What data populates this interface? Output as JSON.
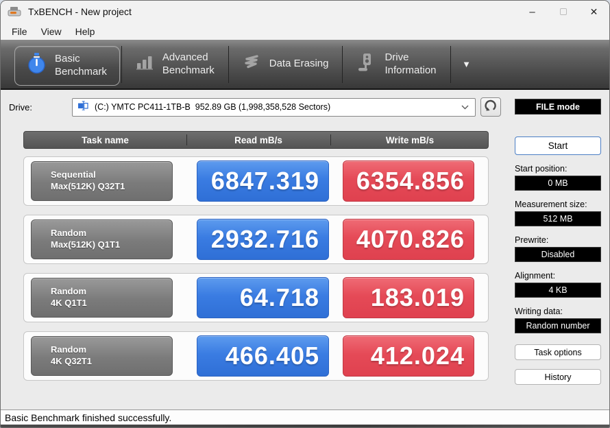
{
  "window": {
    "title": "TxBENCH - New project",
    "minimize_glyph": "–",
    "close_glyph": "✕"
  },
  "menu": {
    "items": [
      "File",
      "View",
      "Help"
    ]
  },
  "toolbar": {
    "tabs": [
      {
        "line1": "Basic",
        "line2": "Benchmark",
        "icon": "stopwatch-icon",
        "active": true
      },
      {
        "line1": "Advanced",
        "line2": "Benchmark",
        "icon": "bar-chart-icon",
        "active": false
      },
      {
        "line1": "Data Erasing",
        "line2": "",
        "icon": "eraser-scribble-icon",
        "active": false
      },
      {
        "line1": "Drive",
        "line2": "Information",
        "icon": "drive-icon",
        "active": false
      }
    ],
    "more_arrow": "▼"
  },
  "drive": {
    "label": "Drive:",
    "selected": "(C:) YMTC PC411-1TB-B  952.89 GB (1,998,358,528 Sectors)"
  },
  "table": {
    "headers": [
      "Task name",
      "Read mB/s",
      "Write mB/s"
    ],
    "rows": [
      {
        "task_line1": "Sequential",
        "task_line2": "Max(512K) Q32T1",
        "read": "6847.319",
        "write": "6354.856"
      },
      {
        "task_line1": "Random",
        "task_line2": "Max(512K) Q1T1",
        "read": "2932.716",
        "write": "4070.826"
      },
      {
        "task_line1": "Random",
        "task_line2": "4K Q1T1",
        "read": "64.718",
        "write": "183.019"
      },
      {
        "task_line1": "Random",
        "task_line2": "4K Q32T1",
        "read": "466.405",
        "write": "412.024"
      }
    ]
  },
  "sidebar": {
    "file_mode": "FILE mode",
    "start_button": "Start",
    "fields": [
      {
        "label": "Start position:",
        "value": "0 MB"
      },
      {
        "label": "Measurement size:",
        "value": "512 MB"
      },
      {
        "label": "Prewrite:",
        "value": "Disabled"
      },
      {
        "label": "Alignment:",
        "value": "4 KB"
      },
      {
        "label": "Writing data:",
        "value": "Random number"
      }
    ],
    "buttons": [
      "Task options",
      "History"
    ]
  },
  "statusbar": {
    "text": "Basic Benchmark finished successfully."
  },
  "colors": {
    "read_blue": "#3a7ce2",
    "write_red": "#e54a57",
    "task_gray": "#7b7b7b",
    "toolbar_dark": "#4f4f4f",
    "accent_blue_icon": "#3f86ec"
  }
}
